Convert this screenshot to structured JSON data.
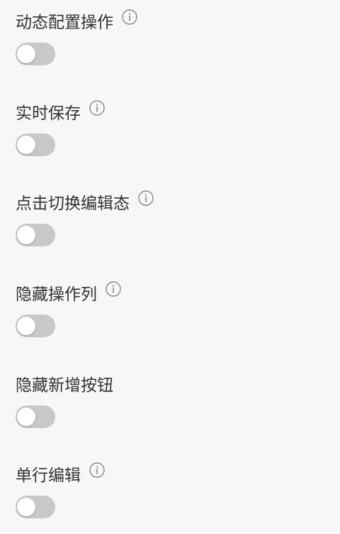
{
  "settings": [
    {
      "label": "动态配置操作",
      "has_info": true,
      "enabled": false
    },
    {
      "label": "实时保存",
      "has_info": true,
      "enabled": false
    },
    {
      "label": "点击切换编辑态",
      "has_info": true,
      "enabled": false
    },
    {
      "label": "隐藏操作列",
      "has_info": true,
      "enabled": false
    },
    {
      "label": "隐藏新增按钮",
      "has_info": false,
      "enabled": false
    },
    {
      "label": "单行编辑",
      "has_info": true,
      "enabled": false
    }
  ],
  "icons": {
    "info": "info-circle-icon"
  },
  "colors": {
    "background": "#f7f7f7",
    "label_text": "#333333",
    "switch_off": "#c8c8c8",
    "info_icon": "#888888"
  }
}
